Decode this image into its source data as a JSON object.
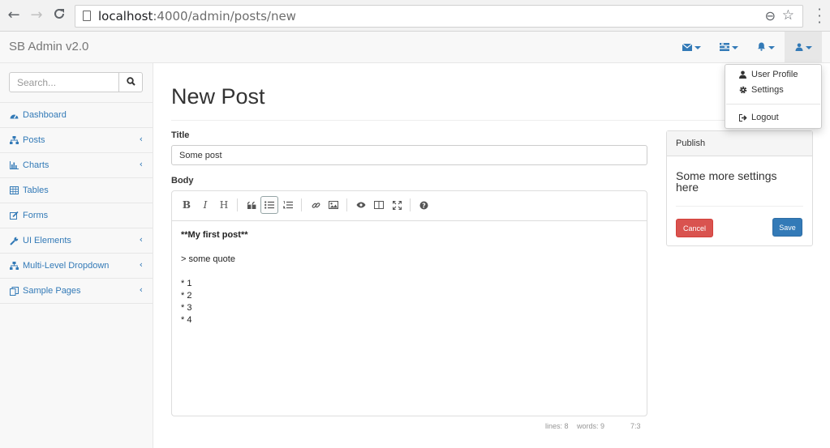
{
  "browser": {
    "url_host": "localhost",
    "url_rest": ":4000/admin/posts/new"
  },
  "navbar": {
    "brand": "SB Admin v2.0",
    "icons": [
      "envelope-icon",
      "tasks-icon",
      "bell-icon",
      "user-icon"
    ]
  },
  "user_menu": {
    "profile": "User Profile",
    "settings": "Settings",
    "logout": "Logout"
  },
  "sidebar": {
    "search_placeholder": "Search...",
    "items": [
      {
        "label": "Dashboard",
        "icon": "dashboard-icon",
        "has_children": false
      },
      {
        "label": "Posts",
        "icon": "sitemap-icon",
        "has_children": true
      },
      {
        "label": "Charts",
        "icon": "bar-chart-icon",
        "has_children": true
      },
      {
        "label": "Tables",
        "icon": "table-icon",
        "has_children": false
      },
      {
        "label": "Forms",
        "icon": "edit-icon",
        "has_children": false
      },
      {
        "label": "UI Elements",
        "icon": "wrench-icon",
        "has_children": true
      },
      {
        "label": "Multi-Level Dropdown",
        "icon": "sitemap-icon",
        "has_children": true
      },
      {
        "label": "Sample Pages",
        "icon": "files-icon",
        "has_children": true
      }
    ]
  },
  "main": {
    "page_title": "New Post",
    "title_label": "Title",
    "title_value": "Some post",
    "body_label": "Body",
    "body_lines": [
      "**My first post**",
      "",
      "> some quote",
      "",
      "* 1",
      "* 2",
      "* 3",
      "* 4"
    ],
    "status": {
      "lines": "lines: 8",
      "words": "words: 9",
      "cursor": "7:3"
    }
  },
  "publish": {
    "header": "Publish",
    "text": "Some more settings here",
    "cancel": "Cancel",
    "save": "Save"
  },
  "colors": {
    "link": "#337ab7",
    "danger": "#d9534f",
    "primary": "#337ab7"
  }
}
